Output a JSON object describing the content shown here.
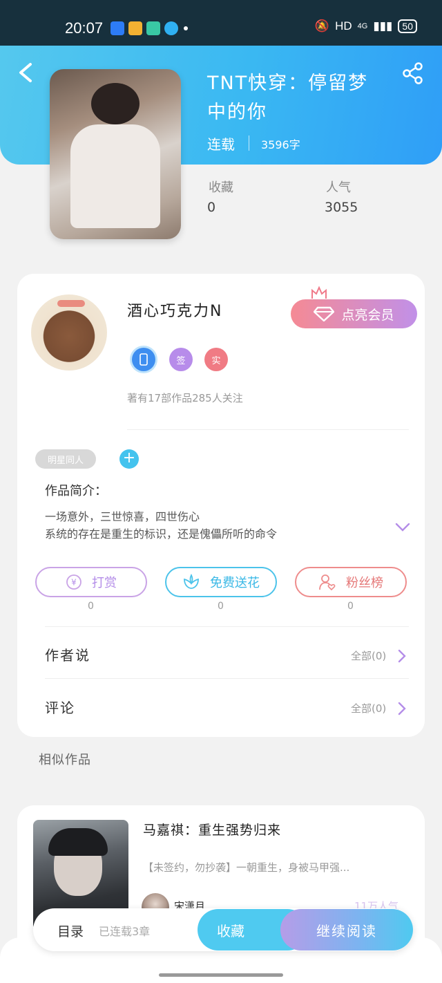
{
  "status_bar": {
    "time": "20:07",
    "network": "HD",
    "signal": "4G",
    "battery": "50"
  },
  "book": {
    "title": "TNT快穿：停留梦中的你",
    "status": "连载",
    "word_count": "3596字",
    "favorites_label": "收藏",
    "favorites_value": "0",
    "popularity_label": "人气",
    "popularity_value": "3055"
  },
  "author": {
    "name": "酒心巧克力N",
    "vip_label": "点亮会员",
    "badges": [
      "签",
      "实"
    ],
    "meta": "著有17部作品285人关注"
  },
  "tags": {
    "items": [
      "明星同人"
    ],
    "add_label": "+"
  },
  "intro": {
    "label": "作品简介：",
    "lines": [
      "一场意外，三世惊喜，四世伤心",
      "系统的存在是重生的标识，还是傀儡所听的命令"
    ]
  },
  "actions": [
    {
      "label": "打赏",
      "count": "0",
      "color": "#c9a3e6"
    },
    {
      "label": "免费送花",
      "count": "0",
      "color": "#4cc3ea"
    },
    {
      "label": "粉丝榜",
      "count": "0",
      "color": "#ee8c8c"
    }
  ],
  "rows": {
    "author_says": {
      "label": "作者说",
      "all": "全部(0)"
    },
    "comments": {
      "label": "评论",
      "all": "全部(0)"
    }
  },
  "similar": {
    "label": "相似作品",
    "item": {
      "title": "马嘉祺：重生强势归来",
      "desc": "【未签约，勿抄袭】一朝重生，身被马甲强...",
      "author": "宋潇月",
      "popularity": "11万人气"
    }
  },
  "bottom": {
    "toc_label": "目录",
    "toc_status": "已连载3章",
    "collect_label": "收藏",
    "read_label": "继续阅读"
  }
}
